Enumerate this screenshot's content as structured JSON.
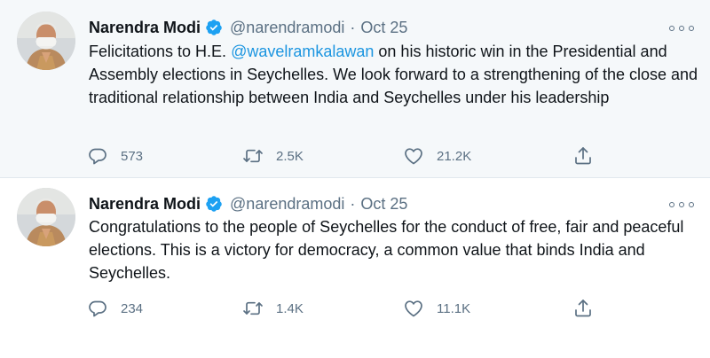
{
  "colors": {
    "accent": "#1b95e0",
    "verified": "#1da1f2",
    "muted": "#5b7083",
    "highlight_bg": "#f5f8fa"
  },
  "tweets": [
    {
      "author_name": "Narendra Modi",
      "verified": true,
      "handle": "@narendramodi",
      "separator": "·",
      "date": "Oct 25",
      "text_before": "Felicitations to H.E. ",
      "mention": "@wavelramkalawan",
      "text_after": " on his historic win in the Presidential and Assembly elections in Seychelles. We look forward to a strengthening of the close and traditional relationship between India and Seychelles under his leadership",
      "replies": "573",
      "retweets": "2.5K",
      "likes": "21.2K"
    },
    {
      "author_name": "Narendra Modi",
      "verified": true,
      "handle": "@narendramodi",
      "separator": "·",
      "date": "Oct 25",
      "text": "Congratulations to the people of Seychelles for the conduct of free, fair and peaceful elections. This is a victory for democracy, a common value that binds India and Seychelles.",
      "replies": "234",
      "retweets": "1.4K",
      "likes": "11.1K"
    }
  ],
  "icons": {
    "reply": "reply-icon",
    "retweet": "retweet-icon",
    "like": "heart-icon",
    "share": "share-icon",
    "more": "more-options-icon",
    "verified": "verified-badge-icon"
  }
}
